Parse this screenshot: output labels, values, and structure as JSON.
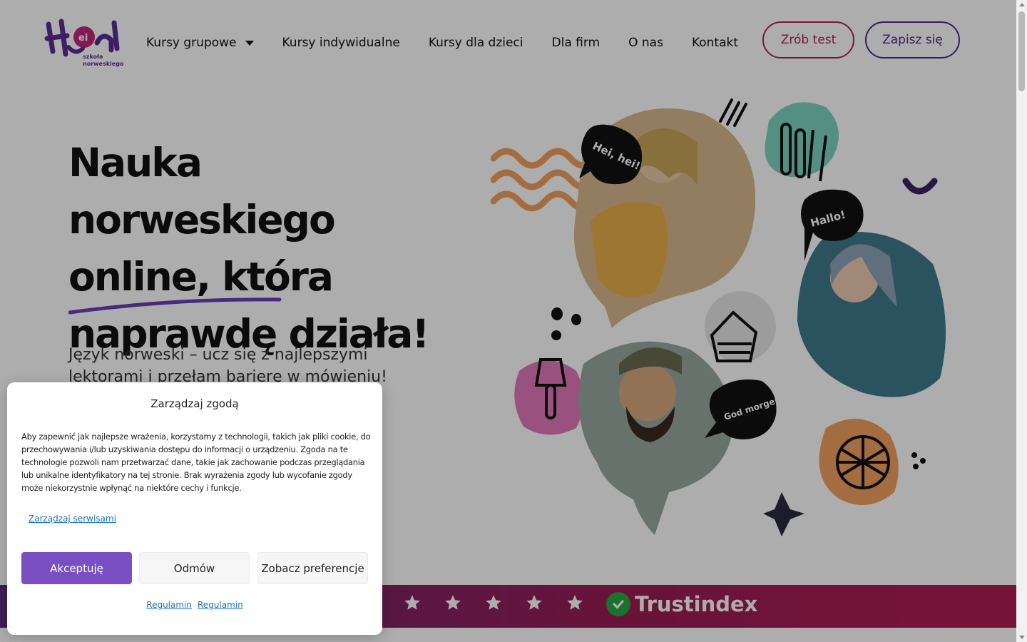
{
  "brand": {
    "logo_text": "Hei",
    "logo_tagline": "szkoła norweskiego",
    "purple": "#5b2d96",
    "pink": "#b3234f"
  },
  "nav": {
    "items": [
      {
        "label": "Kursy grupowe",
        "has_dropdown": true
      },
      {
        "label": "Kursy indywidualne"
      },
      {
        "label": "Kursy dla dzieci"
      },
      {
        "label": "Dla firm"
      },
      {
        "label": "O nas"
      },
      {
        "label": "Kontakt"
      }
    ],
    "test_button": "Zrób test",
    "signup_button": "Zapisz się"
  },
  "hero": {
    "title_line1": "Nauka norweskiego",
    "title_line2": "online, która",
    "title_line3": "naprawdę działa!",
    "subtitle": "Język norweski – ucz się z najlepszymi lektorami i przełam barierę w mówieniu!",
    "bubble_1": "Hei, hei!",
    "bubble_2": "Hallo!",
    "bubble_3": "God morgen!"
  },
  "trust": {
    "stars": 5,
    "brand": "Trustindex"
  },
  "consent": {
    "title": "Zarządzaj zgodą",
    "body": "Aby zapewnić jak najlepsze wrażenia, korzystamy z technologii, takich jak pliki cookie, do przechowywania i/lub uzyskiwania dostępu do informacji o urządzeniu. Zgoda na te technologie pozwoli nam przetwarzać dane, takie jak zachowanie podczas przeglądania lub unikalne identyfikatory na tej stronie. Brak wyrażenia zgody lub wycofanie zgody może niekorzystnie wpłynąć na niektóre cechy i funkcje.",
    "manage_link": "Zarządzaj serwisami",
    "accept": "Akceptuję",
    "deny": "Odmów",
    "preferences": "Zobacz preferencje",
    "footer_link_1": "Regulamin",
    "footer_link_2": "Regulamin"
  }
}
